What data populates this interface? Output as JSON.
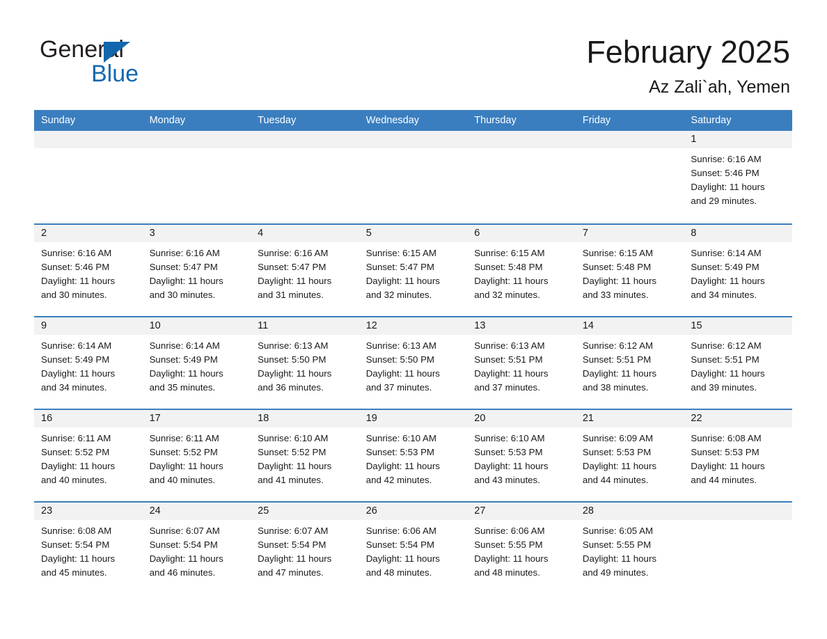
{
  "brand": {
    "name_part1": "General",
    "name_part2": "Blue",
    "accent_color": "#1569b0",
    "triangle_icon": "triangle-icon"
  },
  "header": {
    "month_title": "February 2025",
    "location": "Az Zali`ah, Yemen"
  },
  "calendar": {
    "header_bg": "#3a7ebf",
    "day_band_bg": "#f2f2f2",
    "weekdays": [
      "Sunday",
      "Monday",
      "Tuesday",
      "Wednesday",
      "Thursday",
      "Friday",
      "Saturday"
    ],
    "weeks": [
      [
        {
          "day": "",
          "empty": true
        },
        {
          "day": "",
          "empty": true
        },
        {
          "day": "",
          "empty": true
        },
        {
          "day": "",
          "empty": true
        },
        {
          "day": "",
          "empty": true
        },
        {
          "day": "",
          "empty": true
        },
        {
          "day": "1",
          "sunrise": "Sunrise: 6:16 AM",
          "sunset": "Sunset: 5:46 PM",
          "daylight1": "Daylight: 11 hours",
          "daylight2": "and 29 minutes."
        }
      ],
      [
        {
          "day": "2",
          "sunrise": "Sunrise: 6:16 AM",
          "sunset": "Sunset: 5:46 PM",
          "daylight1": "Daylight: 11 hours",
          "daylight2": "and 30 minutes."
        },
        {
          "day": "3",
          "sunrise": "Sunrise: 6:16 AM",
          "sunset": "Sunset: 5:47 PM",
          "daylight1": "Daylight: 11 hours",
          "daylight2": "and 30 minutes."
        },
        {
          "day": "4",
          "sunrise": "Sunrise: 6:16 AM",
          "sunset": "Sunset: 5:47 PM",
          "daylight1": "Daylight: 11 hours",
          "daylight2": "and 31 minutes."
        },
        {
          "day": "5",
          "sunrise": "Sunrise: 6:15 AM",
          "sunset": "Sunset: 5:47 PM",
          "daylight1": "Daylight: 11 hours",
          "daylight2": "and 32 minutes."
        },
        {
          "day": "6",
          "sunrise": "Sunrise: 6:15 AM",
          "sunset": "Sunset: 5:48 PM",
          "daylight1": "Daylight: 11 hours",
          "daylight2": "and 32 minutes."
        },
        {
          "day": "7",
          "sunrise": "Sunrise: 6:15 AM",
          "sunset": "Sunset: 5:48 PM",
          "daylight1": "Daylight: 11 hours",
          "daylight2": "and 33 minutes."
        },
        {
          "day": "8",
          "sunrise": "Sunrise: 6:14 AM",
          "sunset": "Sunset: 5:49 PM",
          "daylight1": "Daylight: 11 hours",
          "daylight2": "and 34 minutes."
        }
      ],
      [
        {
          "day": "9",
          "sunrise": "Sunrise: 6:14 AM",
          "sunset": "Sunset: 5:49 PM",
          "daylight1": "Daylight: 11 hours",
          "daylight2": "and 34 minutes."
        },
        {
          "day": "10",
          "sunrise": "Sunrise: 6:14 AM",
          "sunset": "Sunset: 5:49 PM",
          "daylight1": "Daylight: 11 hours",
          "daylight2": "and 35 minutes."
        },
        {
          "day": "11",
          "sunrise": "Sunrise: 6:13 AM",
          "sunset": "Sunset: 5:50 PM",
          "daylight1": "Daylight: 11 hours",
          "daylight2": "and 36 minutes."
        },
        {
          "day": "12",
          "sunrise": "Sunrise: 6:13 AM",
          "sunset": "Sunset: 5:50 PM",
          "daylight1": "Daylight: 11 hours",
          "daylight2": "and 37 minutes."
        },
        {
          "day": "13",
          "sunrise": "Sunrise: 6:13 AM",
          "sunset": "Sunset: 5:51 PM",
          "daylight1": "Daylight: 11 hours",
          "daylight2": "and 37 minutes."
        },
        {
          "day": "14",
          "sunrise": "Sunrise: 6:12 AM",
          "sunset": "Sunset: 5:51 PM",
          "daylight1": "Daylight: 11 hours",
          "daylight2": "and 38 minutes."
        },
        {
          "day": "15",
          "sunrise": "Sunrise: 6:12 AM",
          "sunset": "Sunset: 5:51 PM",
          "daylight1": "Daylight: 11 hours",
          "daylight2": "and 39 minutes."
        }
      ],
      [
        {
          "day": "16",
          "sunrise": "Sunrise: 6:11 AM",
          "sunset": "Sunset: 5:52 PM",
          "daylight1": "Daylight: 11 hours",
          "daylight2": "and 40 minutes."
        },
        {
          "day": "17",
          "sunrise": "Sunrise: 6:11 AM",
          "sunset": "Sunset: 5:52 PM",
          "daylight1": "Daylight: 11 hours",
          "daylight2": "and 40 minutes."
        },
        {
          "day": "18",
          "sunrise": "Sunrise: 6:10 AM",
          "sunset": "Sunset: 5:52 PM",
          "daylight1": "Daylight: 11 hours",
          "daylight2": "and 41 minutes."
        },
        {
          "day": "19",
          "sunrise": "Sunrise: 6:10 AM",
          "sunset": "Sunset: 5:53 PM",
          "daylight1": "Daylight: 11 hours",
          "daylight2": "and 42 minutes."
        },
        {
          "day": "20",
          "sunrise": "Sunrise: 6:10 AM",
          "sunset": "Sunset: 5:53 PM",
          "daylight1": "Daylight: 11 hours",
          "daylight2": "and 43 minutes."
        },
        {
          "day": "21",
          "sunrise": "Sunrise: 6:09 AM",
          "sunset": "Sunset: 5:53 PM",
          "daylight1": "Daylight: 11 hours",
          "daylight2": "and 44 minutes."
        },
        {
          "day": "22",
          "sunrise": "Sunrise: 6:08 AM",
          "sunset": "Sunset: 5:53 PM",
          "daylight1": "Daylight: 11 hours",
          "daylight2": "and 44 minutes."
        }
      ],
      [
        {
          "day": "23",
          "sunrise": "Sunrise: 6:08 AM",
          "sunset": "Sunset: 5:54 PM",
          "daylight1": "Daylight: 11 hours",
          "daylight2": "and 45 minutes."
        },
        {
          "day": "24",
          "sunrise": "Sunrise: 6:07 AM",
          "sunset": "Sunset: 5:54 PM",
          "daylight1": "Daylight: 11 hours",
          "daylight2": "and 46 minutes."
        },
        {
          "day": "25",
          "sunrise": "Sunrise: 6:07 AM",
          "sunset": "Sunset: 5:54 PM",
          "daylight1": "Daylight: 11 hours",
          "daylight2": "and 47 minutes."
        },
        {
          "day": "26",
          "sunrise": "Sunrise: 6:06 AM",
          "sunset": "Sunset: 5:54 PM",
          "daylight1": "Daylight: 11 hours",
          "daylight2": "and 48 minutes."
        },
        {
          "day": "27",
          "sunrise": "Sunrise: 6:06 AM",
          "sunset": "Sunset: 5:55 PM",
          "daylight1": "Daylight: 11 hours",
          "daylight2": "and 48 minutes."
        },
        {
          "day": "28",
          "sunrise": "Sunrise: 6:05 AM",
          "sunset": "Sunset: 5:55 PM",
          "daylight1": "Daylight: 11 hours",
          "daylight2": "and 49 minutes."
        },
        {
          "day": "",
          "empty": true
        }
      ]
    ]
  }
}
